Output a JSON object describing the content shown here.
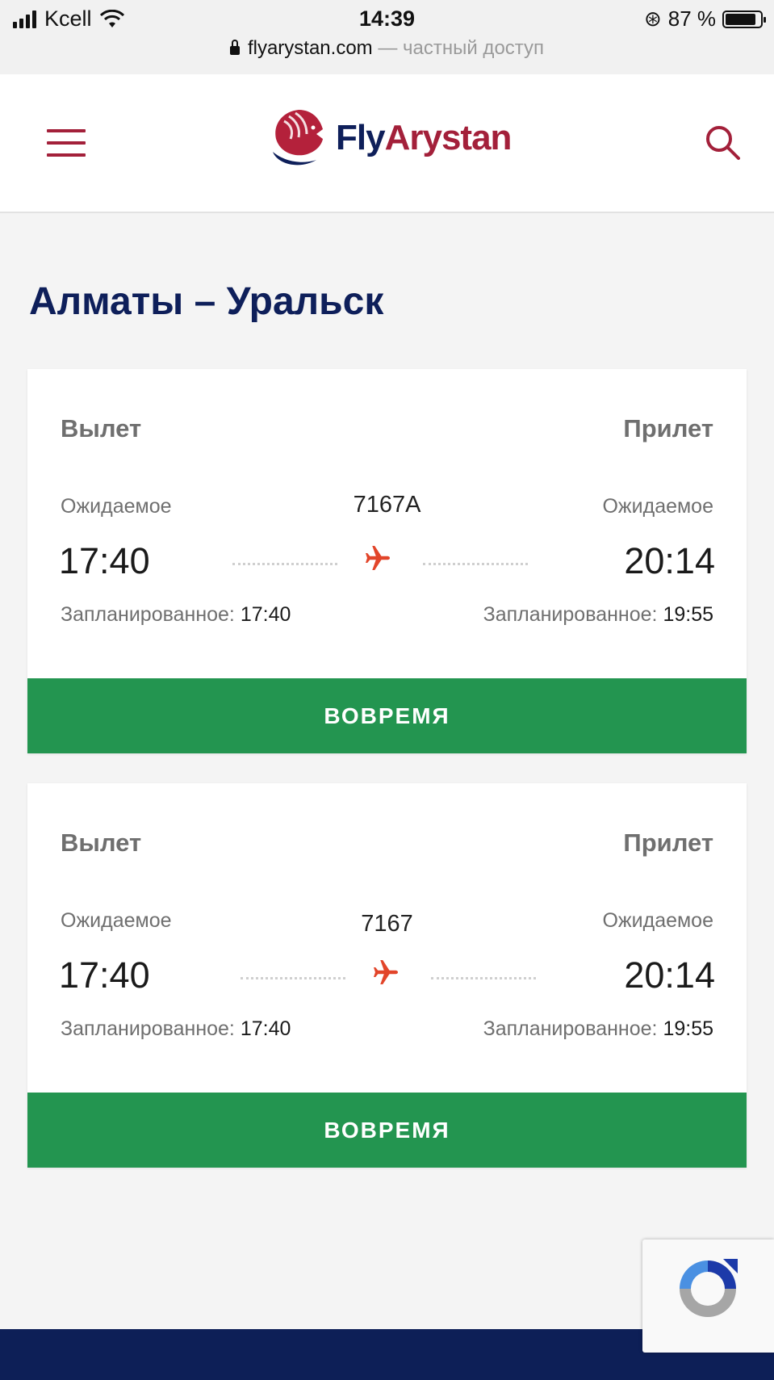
{
  "status_bar": {
    "carrier": "Kcell",
    "time": "14:39",
    "battery": "87 %",
    "battery_level": 0.87
  },
  "url_bar": {
    "domain": "flyarystan.com",
    "mode": "— частный доступ"
  },
  "header": {
    "logo_part1": "Fly",
    "logo_part2": "Arystan"
  },
  "colors": {
    "brand_red": "#a3203a",
    "brand_navy": "#0e1f5a",
    "status_green": "#239550",
    "plane_orange": "#e2452a"
  },
  "page_title": "Алматы – Уральск",
  "flights": [
    {
      "departure_label": "Вылет",
      "arrival_label": "Прилет",
      "flight_number": "7167A",
      "departure_expected_label": "Ожидаемое",
      "arrival_expected_label": "Ожидаемое",
      "departure_expected": "17:40",
      "arrival_expected": "20:14",
      "scheduled_label": "Запланированное:",
      "departure_scheduled": "17:40",
      "arrival_scheduled": "19:55",
      "status": "ВОВРЕМЯ"
    },
    {
      "departure_label": "Вылет",
      "arrival_label": "Прилет",
      "flight_number": "7167",
      "departure_expected_label": "Ожидаемое",
      "arrival_expected_label": "Ожидаемое",
      "departure_expected": "17:40",
      "arrival_expected": "20:14",
      "scheduled_label": "Запланированное:",
      "departure_scheduled": "17:40",
      "arrival_scheduled": "19:55",
      "status": "ВОВРЕМЯ"
    }
  ],
  "icons": {
    "menu": "hamburger-menu-icon",
    "search": "search-icon",
    "plane": "plane-icon",
    "logo": "lion-logo-icon",
    "captcha": "recaptcha-icon"
  }
}
